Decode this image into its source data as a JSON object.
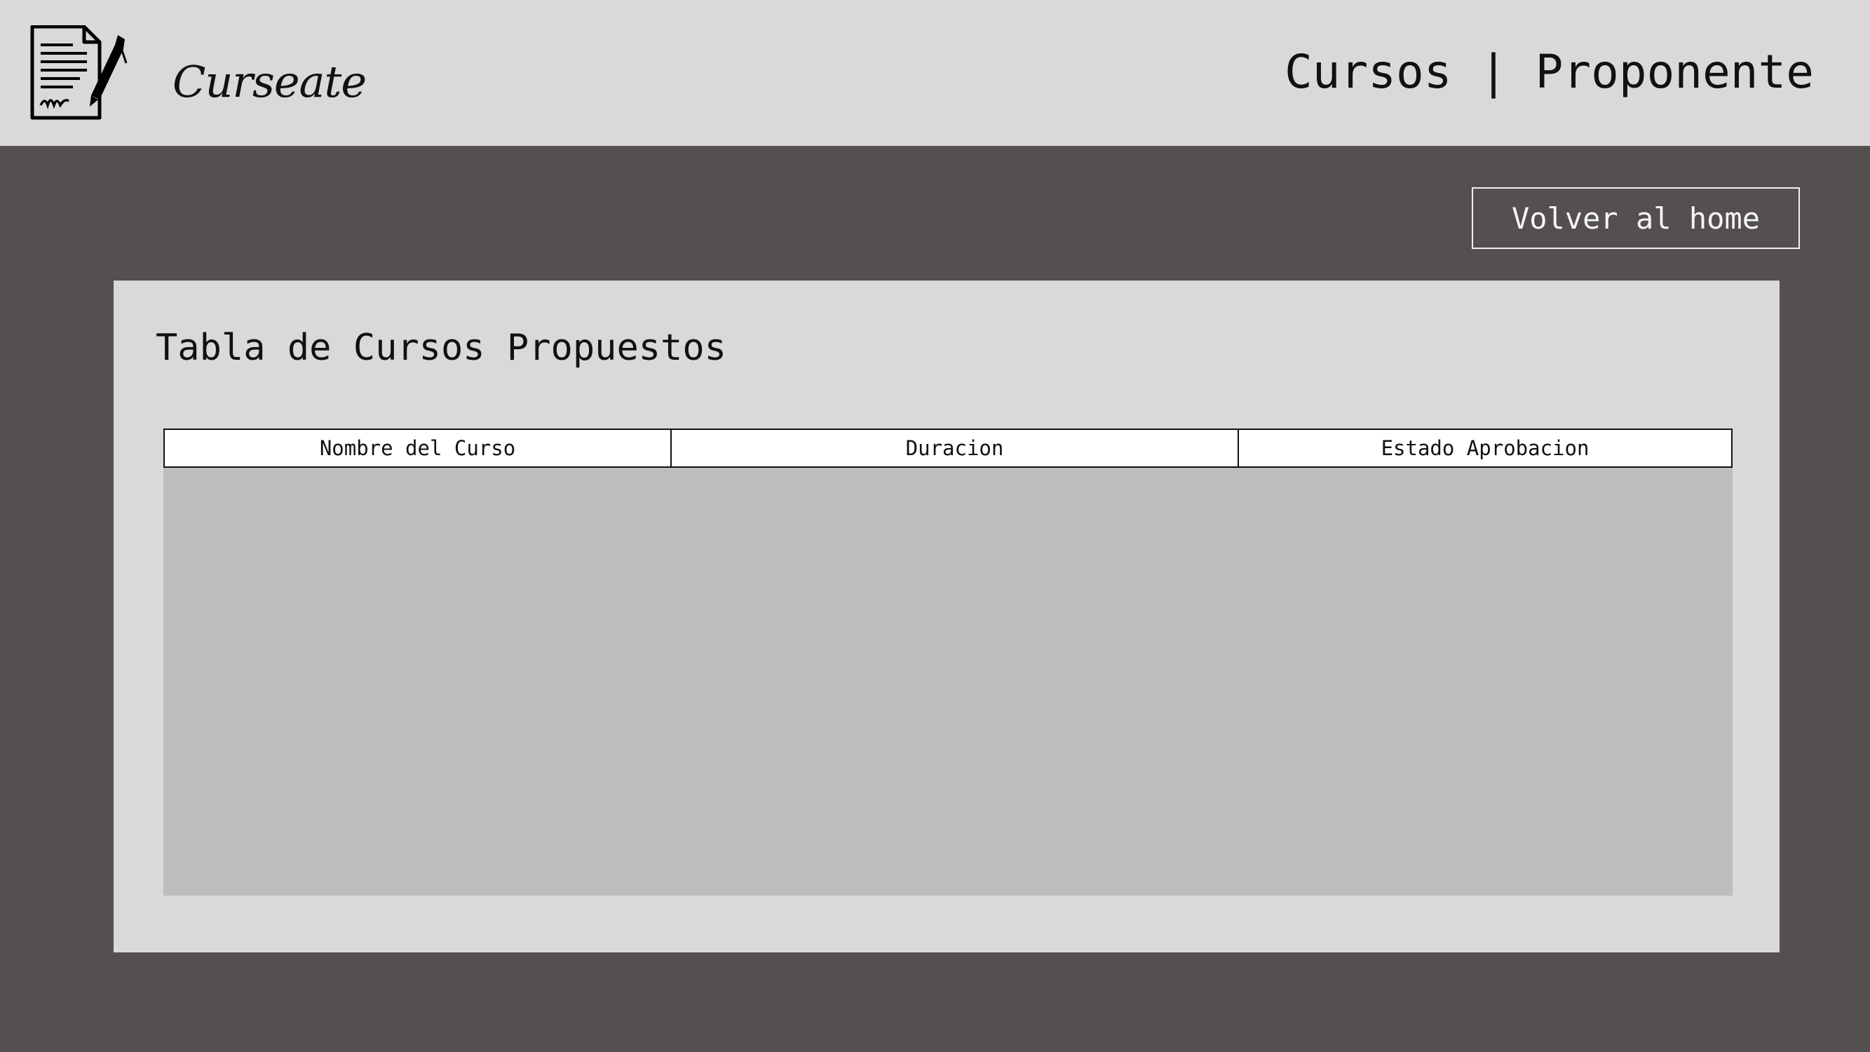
{
  "header": {
    "brand_name": "Curseate",
    "logo_icon": "document-pen-icon",
    "page_heading": "Cursos | Proponente"
  },
  "actions": {
    "back_label": "Volver al home"
  },
  "panel": {
    "title": "Tabla de Cursos Propuestos",
    "table": {
      "columns": [
        "Nombre del Curso",
        "Duracion",
        "Estado Aprobacion"
      ],
      "rows": []
    }
  },
  "colors": {
    "background": "#555050",
    "header_bg": "#d9d9d9",
    "panel_bg": "#d9d9d9",
    "table_body_bg": "#bdbdbd",
    "table_header_bg": "#ffffff"
  }
}
